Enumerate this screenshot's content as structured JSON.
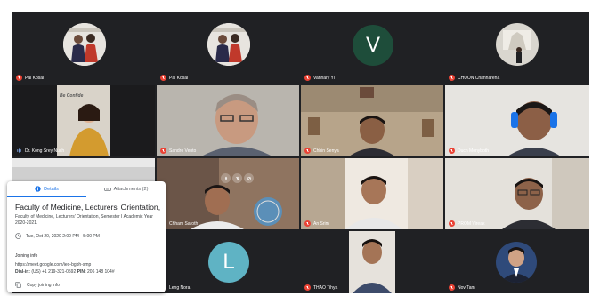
{
  "participants": {
    "p1": "Pai Kosal",
    "p2": "Pai Kosal",
    "p3": "Vannary Yi",
    "p4": "CHUON Channarena",
    "p5": "Dr. Kong Srey Nuch",
    "p6": "Sandro Vento",
    "p7": "Chhin Senya",
    "p8": "Duch Monyboth",
    "p9": "Chham Saroth",
    "p10": "An Srim",
    "p11": "PROM Vireak",
    "p12": "Leng Nora",
    "p13": "THAO Tihya",
    "p14": "Nov Tam"
  },
  "letters": {
    "v": "V",
    "l": "L"
  },
  "slide_text": "Be Confide",
  "card": {
    "tab_details": "Details",
    "tab_attachments": "Attachments (2)",
    "title": "Faculty of Medicine, Lecturers' Orientation, S...",
    "description": "Faculty of Medicine, Lecturers' Orientation, Semester I Academic Year 2020-2021.",
    "date": "Tue, Oct 20, 2020 2:00 PM - 5:00 PM",
    "joining_heading": "Joining info",
    "url": "https://meet.google.com/ieo-bgbh-smp",
    "dial_label": "Dial-in:",
    "dial_number": "(US) +1 219-321-0592",
    "pin_label": "PIN:",
    "pin_value": "206 148 104#",
    "copy_label": "Copy joining info"
  },
  "colors": {
    "tile_bg": "#3c4043",
    "grid_bg": "#202124",
    "v_avatar": "#1e4d3a",
    "l_avatar": "#5fb3c4",
    "accent": "#1a73e8",
    "mute": "#ea4335"
  }
}
